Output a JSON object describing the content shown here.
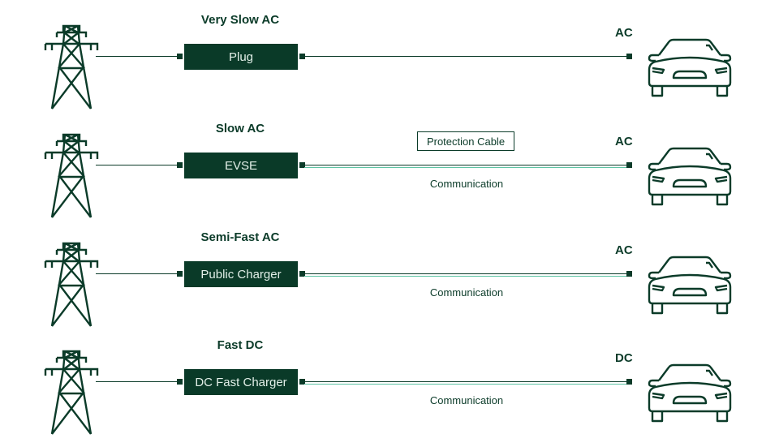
{
  "colors": {
    "dark_green": "#0a3a28",
    "line": "#0b3b29",
    "communication_line": "#5ec4a4",
    "box_text": "#e2efe8"
  },
  "icons": {
    "source": "power-tower-icon",
    "vehicle": "car-front-icon"
  },
  "rows": [
    {
      "title": "Very Slow AC",
      "device": "Plug",
      "vehicle_label": "AC",
      "communication": "",
      "cable_label": ""
    },
    {
      "title": "Slow AC",
      "device": "EVSE",
      "vehicle_label": "AC",
      "communication": "Communication",
      "cable_label": "Protection Cable"
    },
    {
      "title": "Semi-Fast AC",
      "device": "Public Charger",
      "vehicle_label": "AC",
      "communication": "Communication",
      "cable_label": ""
    },
    {
      "title": "Fast DC",
      "device": "DC Fast Charger",
      "vehicle_label": "DC",
      "communication": "Communication",
      "cable_label": ""
    }
  ]
}
